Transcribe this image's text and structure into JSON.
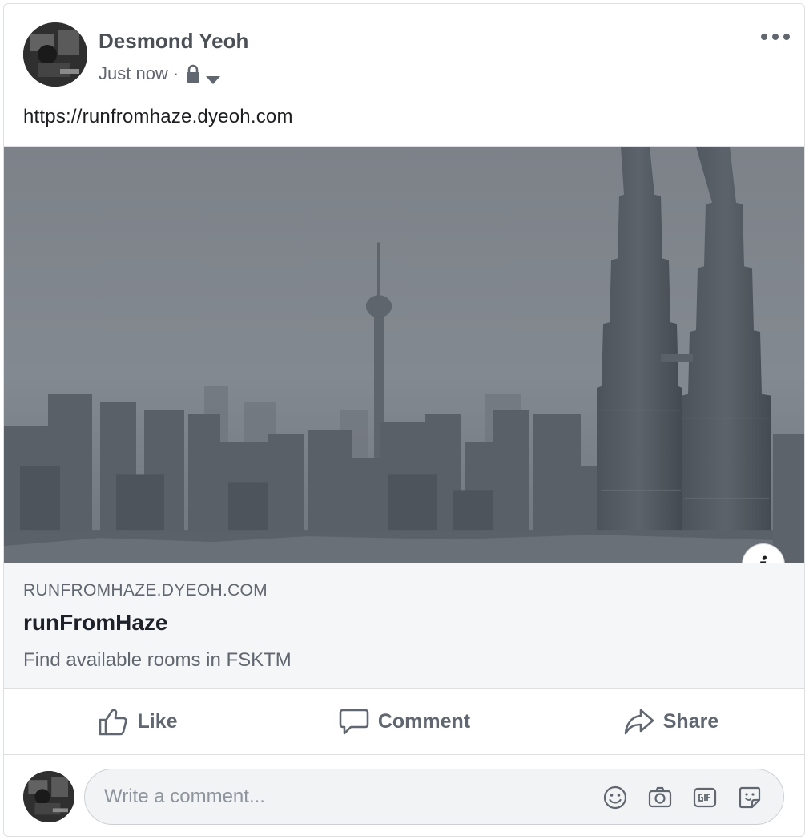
{
  "post": {
    "author": "Desmond Yeoh",
    "timestamp": "Just now",
    "separator": "·",
    "audience_icon": "lock-icon",
    "text": "https://runfromhaze.dyeoh.com"
  },
  "link_preview": {
    "domain": "RUNFROMHAZE.DYEOH.COM",
    "title": "runFromHaze",
    "description": "Find available rooms in FSKTM",
    "info_label": "i"
  },
  "actions": {
    "like": "Like",
    "comment": "Comment",
    "share": "Share"
  },
  "comment_composer": {
    "placeholder": "Write a comment...",
    "tools": [
      "emoji-icon",
      "camera-icon",
      "gif-icon",
      "sticker-icon"
    ]
  },
  "colors": {
    "text_secondary": "#606770",
    "border": "#dddfe2",
    "caption_bg": "#f5f6f7"
  }
}
